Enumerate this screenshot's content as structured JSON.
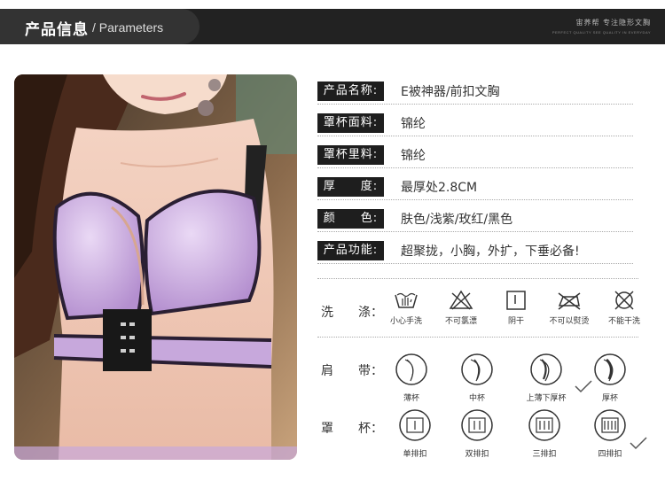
{
  "header": {
    "title_zh": "产品信息",
    "title_en": "/ Parameters",
    "brand_zh": "宙荞帮 专注隐形文胸",
    "brand_en": "PERFECT QUALITY SEE QUALITY IN EVERYDAY"
  },
  "params": [
    {
      "label": "产品名称:",
      "value": "E被神器/前扣文胸"
    },
    {
      "label": "罩杯面料:",
      "value": "锦纶"
    },
    {
      "label": "罩杯里料:",
      "value": "锦纶"
    },
    {
      "label": "厚　　度:",
      "value": "最厚处2.8CM"
    },
    {
      "label": "颜　　色:",
      "value": "肤色/浅紫/玫红/黑色"
    },
    {
      "label": "产品功能:",
      "value": "超聚拢，小胸，外扩，下垂必备!"
    }
  ],
  "washing": {
    "label": "洗　　涤：",
    "items": [
      {
        "icon": "hand-wash-icon",
        "caption": "小心手洗"
      },
      {
        "icon": "no-bleach-icon",
        "caption": "不可氯漂"
      },
      {
        "icon": "line-dry-icon",
        "caption": "阴干"
      },
      {
        "icon": "no-iron-icon",
        "caption": "不可以熨烫"
      },
      {
        "icon": "no-dry-clean-icon",
        "caption": "不能干洗"
      }
    ]
  },
  "strap": {
    "label": "肩　　带：",
    "items": [
      {
        "icon": "thin-cup-icon",
        "caption": "薄杯",
        "selected": false
      },
      {
        "icon": "medium-cup-icon",
        "caption": "中杯",
        "selected": false
      },
      {
        "icon": "thin-top-thick-bottom-cup-icon",
        "caption": "上薄下厚杯",
        "selected": true
      },
      {
        "icon": "thick-cup-icon",
        "caption": "厚杯",
        "selected": false
      }
    ]
  },
  "cup": {
    "label": "罩　　杯：",
    "items": [
      {
        "icon": "single-hook-icon",
        "caption": "单排扣",
        "selected": false
      },
      {
        "icon": "double-hook-icon",
        "caption": "双排扣",
        "selected": false
      },
      {
        "icon": "triple-hook-icon",
        "caption": "三排扣",
        "selected": false
      },
      {
        "icon": "quad-hook-icon",
        "caption": "四排扣",
        "selected": true
      }
    ]
  },
  "colors": {
    "bar": "#222222",
    "label_bg": "#1e1e1e",
    "bra_purple": "#c7a8dc"
  }
}
